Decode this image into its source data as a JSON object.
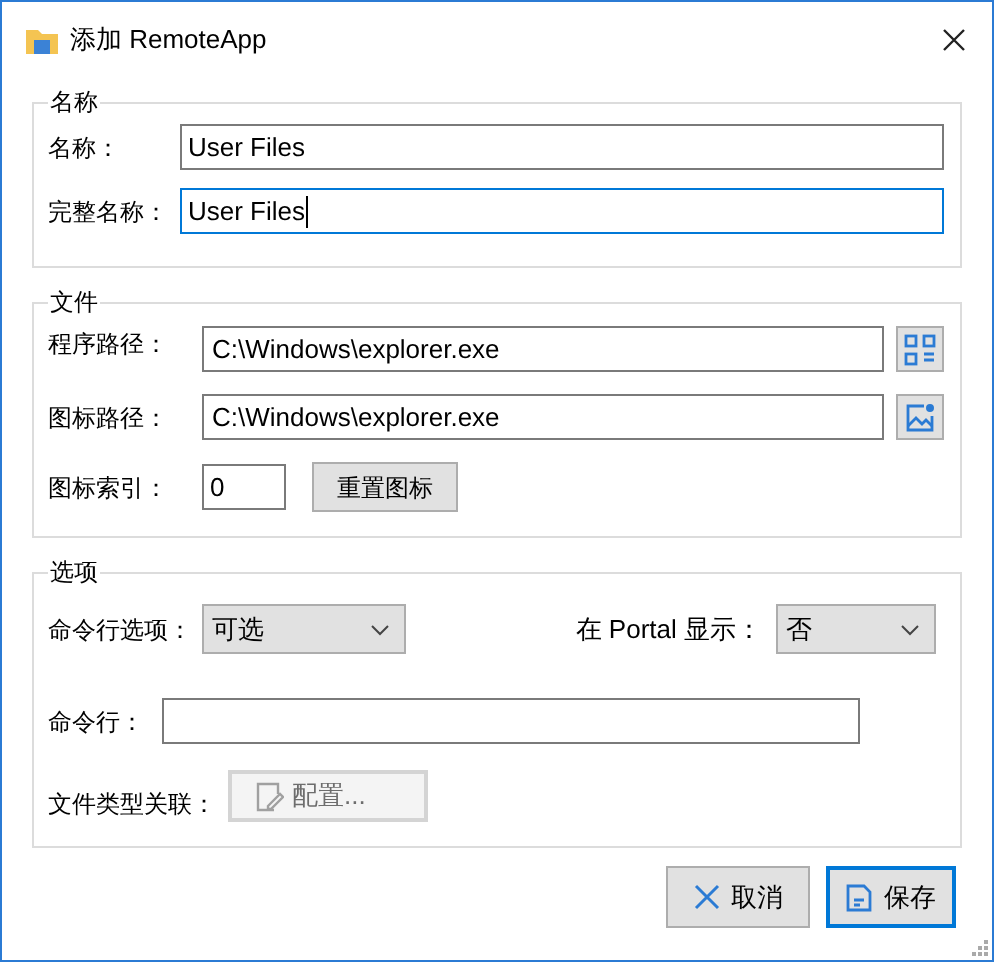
{
  "window": {
    "title": "添加 RemoteApp"
  },
  "name_group": {
    "title": "名称",
    "fields": [
      {
        "label": "名称：",
        "value": "User Files",
        "focused": false
      },
      {
        "label": "完整名称：",
        "value": "User Files",
        "focused": true
      }
    ]
  },
  "file_group": {
    "title": "文件",
    "program_path": {
      "label": "程序路径：",
      "value": "C:\\Windows\\explorer.exe"
    },
    "icon_path": {
      "label": "图标路径：",
      "value": "C:\\Windows\\explorer.exe"
    },
    "icon_index": {
      "label": "图标索引：",
      "value": "0"
    },
    "reset_button": "重置图标"
  },
  "options_group": {
    "title": "选项",
    "cmd_option": {
      "label": "命令行选项：",
      "value": "可选"
    },
    "portal": {
      "label": "在 Portal 显示：",
      "value": "否"
    },
    "command_line": {
      "label": "命令行："
    },
    "file_types": {
      "label": "文件类型关联：",
      "button": "配置...",
      "disabled": true
    }
  },
  "buttons": [
    {
      "label": "取消",
      "kind": "cancel",
      "default": false
    },
    {
      "label": "保存",
      "kind": "save",
      "default": true
    }
  ]
}
